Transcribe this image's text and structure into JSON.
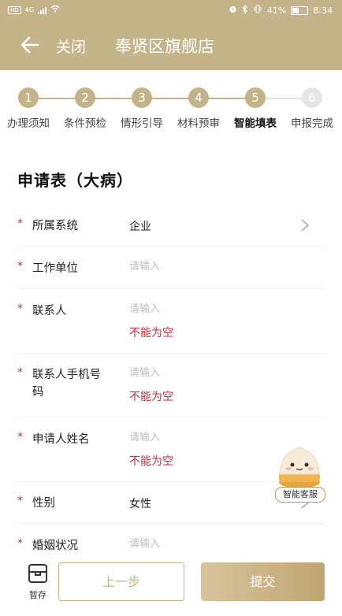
{
  "status_bar": {
    "left_badge": "HD",
    "network": "4G",
    "battery": "41%",
    "time": "8:34"
  },
  "header": {
    "back_icon": "arrow-left-icon",
    "close_label": "关闭",
    "title": "奉贤区旗舰店"
  },
  "steps": [
    {
      "number": "1",
      "label": "办理须知",
      "state": "done"
    },
    {
      "number": "2",
      "label": "条件预检",
      "state": "done"
    },
    {
      "number": "3",
      "label": "情形引导",
      "state": "done"
    },
    {
      "number": "4",
      "label": "材料预审",
      "state": "done"
    },
    {
      "number": "5",
      "label": "智能填表",
      "state": "current"
    },
    {
      "number": "6",
      "label": "申报完成",
      "state": "pending"
    }
  ],
  "form": {
    "title": "申请表（大病）",
    "required_mark": "*",
    "fields": [
      {
        "label": "所属系统",
        "value": "企业",
        "placeholder": "",
        "error": "",
        "has_chevron": true
      },
      {
        "label": "工作单位",
        "value": "",
        "placeholder": "请输入",
        "error": "",
        "has_chevron": false
      },
      {
        "label": "联系人",
        "value": "",
        "placeholder": "请输入",
        "error": "不能为空",
        "has_chevron": false
      },
      {
        "label": "联系人手机号码",
        "value": "",
        "placeholder": "请输入",
        "error": "不能为空",
        "has_chevron": false
      },
      {
        "label": "申请人姓名",
        "value": "",
        "placeholder": "请输入",
        "error": "不能为空",
        "has_chevron": false
      },
      {
        "label": "性别",
        "value": "女性",
        "placeholder": "",
        "error": "",
        "has_chevron": true
      },
      {
        "label": "婚姻状况",
        "value": "",
        "placeholder": "请输入",
        "error": "",
        "has_chevron": false
      }
    ]
  },
  "assistant": {
    "label": "智能客服",
    "icon": "steamed-bun-mascot-icon"
  },
  "bottom_bar": {
    "save_draft_label": "暂存",
    "save_draft_icon": "inbox-tray-icon",
    "prev_label": "上一步",
    "submit_label": "提交"
  },
  "colors": {
    "brand": "#c5b48a",
    "error": "#c0303a",
    "placeholder": "#bdbdbd"
  }
}
